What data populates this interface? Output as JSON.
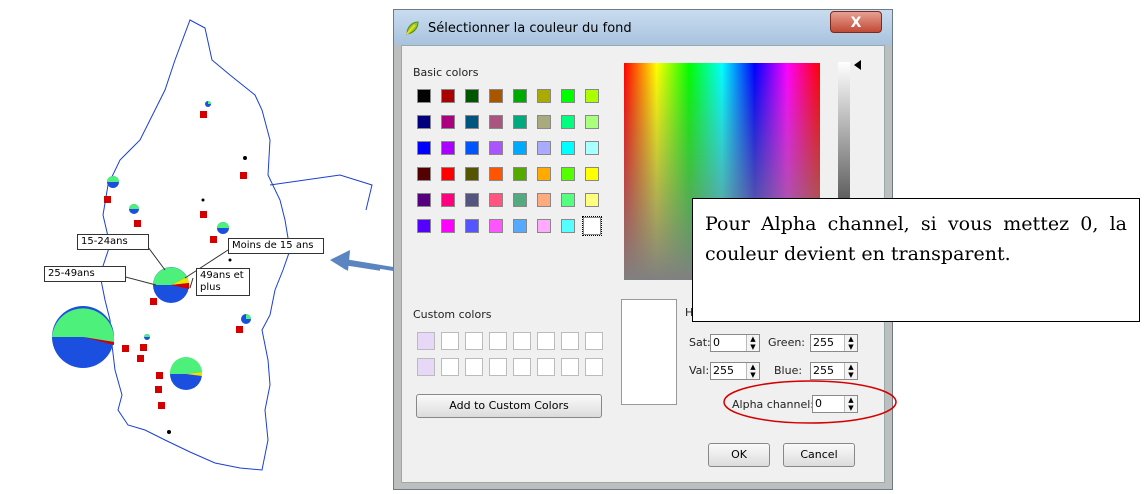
{
  "map": {
    "labels": {
      "age15_24": "15-24ans",
      "moins15": "Moins de 15 ans",
      "age25_49": "25-49ans",
      "age49plus": "49ans et plus"
    }
  },
  "dialog": {
    "title": "Sélectionner la couleur du fond",
    "close_label": "X",
    "basic_colors_label": "Basic colors",
    "custom_colors_label": "Custom colors",
    "add_custom_label": "Add to Custom Colors",
    "basic_colors": [
      "#000000",
      "#aa0000",
      "#005500",
      "#aa5500",
      "#00aa00",
      "#aaaa00",
      "#00ff00",
      "#aaff00",
      "#00007f",
      "#aa007f",
      "#00557f",
      "#aa557f",
      "#00aa7f",
      "#aaaa7f",
      "#00ff7f",
      "#aaff7f",
      "#0000ff",
      "#aa00ff",
      "#0055ff",
      "#aa55ff",
      "#00aaff",
      "#aaaaff",
      "#00ffff",
      "#aaffff",
      "#550000",
      "#ff0000",
      "#555500",
      "#ff5500",
      "#55aa00",
      "#ffaa00",
      "#55ff00",
      "#ffff00",
      "#55007f",
      "#ff007f",
      "#55557f",
      "#ff557f",
      "#55aa7f",
      "#ffaa7f",
      "#55ff7f",
      "#ffff7f",
      "#5500ff",
      "#ff00ff",
      "#5555ff",
      "#ff55ff",
      "#55aaff",
      "#ffaaff",
      "#55ffff",
      "#ffffff"
    ],
    "custom_colors": [
      "#e8d8f8",
      "#ffffff",
      "#ffffff",
      "#ffffff",
      "#ffffff",
      "#ffffff",
      "#ffffff",
      "#ffffff",
      "#e8d8f8",
      "#ffffff",
      "#ffffff",
      "#ffffff",
      "#ffffff",
      "#ffffff",
      "#ffffff",
      "#ffffff"
    ],
    "hue_label_partial": "H",
    "sat": {
      "label": "Sat:",
      "value": "0"
    },
    "val": {
      "label": "Val:",
      "value": "255"
    },
    "green": {
      "label": "Green:",
      "value": "255"
    },
    "blue": {
      "label": "Blue:",
      "value": "255"
    },
    "alpha": {
      "label": "Alpha channel:",
      "value": "0"
    },
    "ok_label": "OK",
    "cancel_label": "Cancel"
  },
  "note": {
    "text": "Pour Alpha channel, si vous mettez 0, la couleur devient en transparent."
  },
  "colors": {
    "map_outline": "#1a3fd6",
    "pie_green": "#4cf07a",
    "pie_blue": "#1b4fe0",
    "pie_red": "#d40000",
    "pie_yellow": "#f2e200",
    "highlight_red": "#d40000",
    "arrow": "#5b85c0"
  }
}
